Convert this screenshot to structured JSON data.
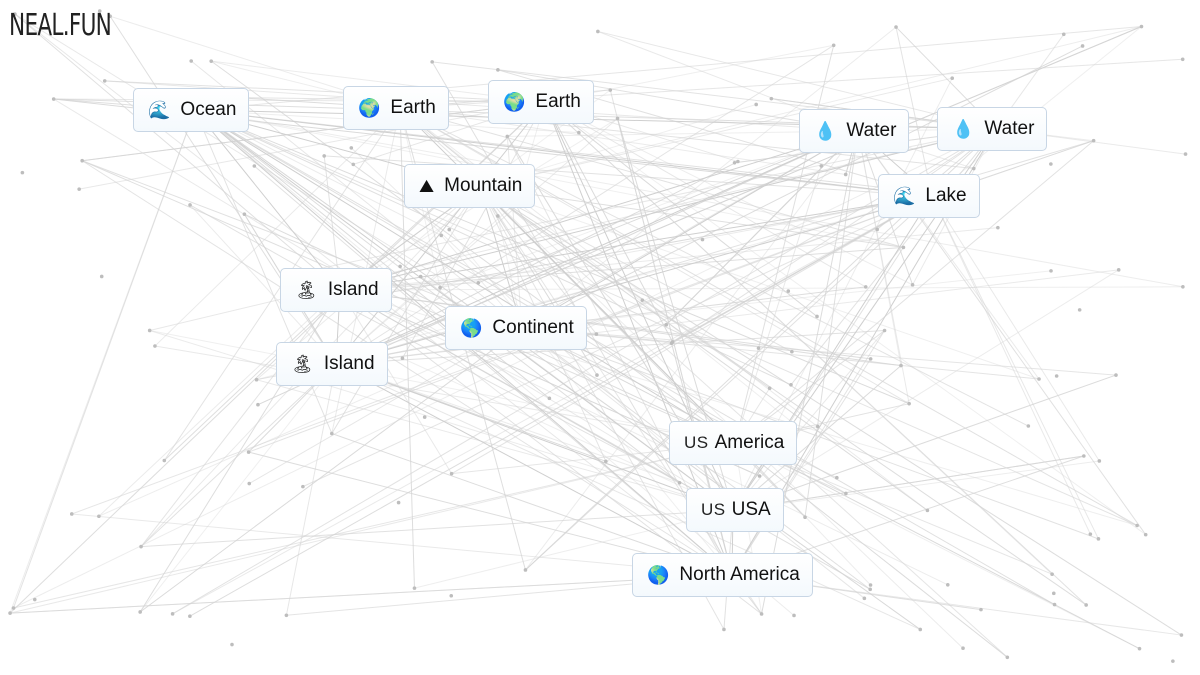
{
  "site": {
    "logo": "NEAL.FUN"
  },
  "nodes": [
    {
      "id": "ocean",
      "label": "Ocean",
      "icon": "wave-icon",
      "glyph": "🌊"
    },
    {
      "id": "earth-1",
      "label": "Earth",
      "icon": "globe-africa-icon",
      "glyph": "🌍"
    },
    {
      "id": "earth-2",
      "label": "Earth",
      "icon": "globe-africa-icon",
      "glyph": "🌍"
    },
    {
      "id": "water-1",
      "label": "Water",
      "icon": "droplet-icon",
      "glyph": "💧"
    },
    {
      "id": "water-2",
      "label": "Water",
      "icon": "droplet-icon",
      "glyph": "💧"
    },
    {
      "id": "mountain",
      "label": "Mountain",
      "icon": "mountain-icon",
      "glyph": "⛰"
    },
    {
      "id": "lake",
      "label": "Lake",
      "icon": "wave-icon",
      "glyph": "🌊"
    },
    {
      "id": "island-1",
      "label": "Island",
      "icon": "island-icon",
      "glyph": "🏝"
    },
    {
      "id": "continent",
      "label": "Continent",
      "icon": "globe-americas-icon",
      "glyph": "🌎"
    },
    {
      "id": "island-2",
      "label": "Island",
      "icon": "island-icon",
      "glyph": "🏝"
    },
    {
      "id": "america",
      "label": "America",
      "icon": "us-flag-icon",
      "glyph": "US"
    },
    {
      "id": "usa",
      "label": "USA",
      "icon": "us-flag-icon",
      "glyph": "US"
    },
    {
      "id": "north-america",
      "label": "North America",
      "icon": "globe-americas-icon",
      "glyph": "🌎"
    }
  ]
}
